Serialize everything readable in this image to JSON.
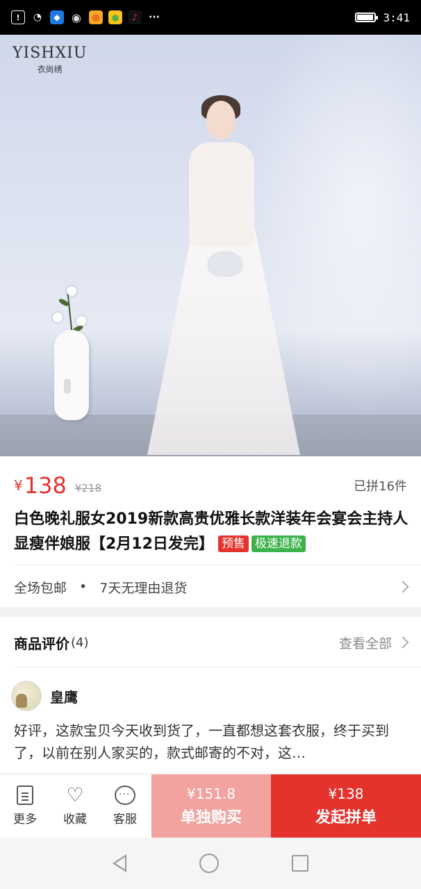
{
  "status_bar": {
    "time": "3:41",
    "icons": [
      "alert-icon",
      "wifi-icon",
      "shield-app-icon",
      "qq-icon",
      "weibo-icon",
      "fruit-app-icon",
      "tiktok-icon",
      "more-dots-icon"
    ]
  },
  "hero": {
    "brand_logo": "YISHXIU",
    "brand_sub": "衣尚绣"
  },
  "product": {
    "price_symbol": "¥",
    "price": "138",
    "original_price": "¥218",
    "sold": "已拼16件",
    "title": "白色晚礼服女2019新款高贵优雅长款洋装年会宴会主持人显瘦伴娘服【2月12日发完】",
    "tags": [
      "预售",
      "极速退款"
    ]
  },
  "services": {
    "free_shipping": "全场包邮",
    "separator": "•",
    "returns": "7天无理由退货"
  },
  "reviews": {
    "label": "商品评价",
    "count": "(4)",
    "view_all": "查看全部",
    "items": [
      {
        "name": "皇鹰",
        "text": "好评，这款宝贝今天收到货了，一直都想这套衣服，终于买到了，以前在别人家买的，款式邮寄的不对，这…"
      }
    ]
  },
  "action_bar": {
    "more": "更多",
    "favorite": "收藏",
    "service": "客服",
    "single_price": "¥151.8",
    "single_label": "单独购买",
    "group_price": "¥138",
    "group_label": "发起拼单"
  },
  "colors": {
    "accent": "#e5322d",
    "single_buy": "#f2a3a0",
    "tag_green": "#3bb34a"
  }
}
